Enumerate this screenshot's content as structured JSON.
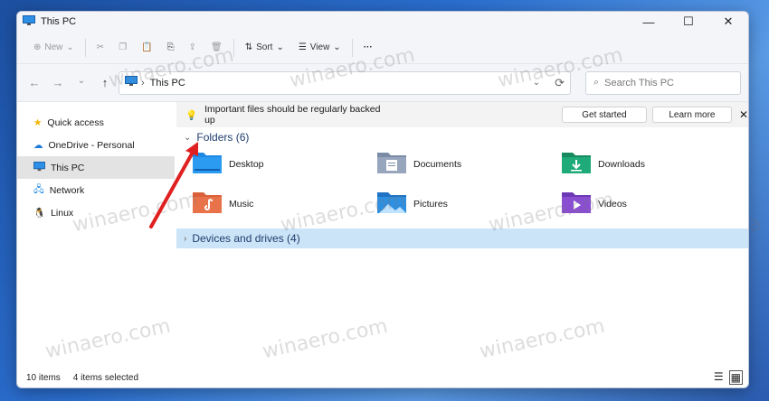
{
  "window": {
    "title": "This PC",
    "controls": {
      "minimize": "—",
      "maximize": "☐",
      "close": "✕"
    }
  },
  "toolbar": {
    "new_label": "New",
    "sort_label": "Sort",
    "view_label": "View",
    "more_label": "···"
  },
  "navbar": {
    "crumb": "This PC",
    "search_placeholder": "Search This PC"
  },
  "sidebar": {
    "items": [
      {
        "label": "Quick access",
        "icon": "star-icon"
      },
      {
        "label": "OneDrive - Personal",
        "icon": "cloud-icon"
      },
      {
        "label": "This PC",
        "icon": "monitor-icon",
        "selected": true
      },
      {
        "label": "Network",
        "icon": "network-icon"
      },
      {
        "label": "Linux",
        "icon": "penguin-icon"
      }
    ]
  },
  "banner": {
    "text": "Important files should be regularly backed up",
    "get_started": "Get started",
    "learn_more": "Learn more"
  },
  "folders_section": {
    "title": "Folders (6)",
    "items": [
      {
        "label": "Desktop",
        "color": "#1e88e5"
      },
      {
        "label": "Documents",
        "color": "#7a8ba6"
      },
      {
        "label": "Downloads",
        "color": "#1faa7a"
      },
      {
        "label": "Music",
        "color": "#e8734a"
      },
      {
        "label": "Pictures",
        "color": "#2f8fe0"
      },
      {
        "label": "Videos",
        "color": "#8a4fd1"
      }
    ]
  },
  "devices_section": {
    "title": "Devices and drives (4)"
  },
  "status": {
    "items_count": "10 items",
    "selected": "4 items selected"
  },
  "watermark_text": "winaero.com",
  "colors": {
    "selection": "#e3e3e3",
    "section_header_bg": "#cce4f7",
    "arrow": "#e02020"
  }
}
